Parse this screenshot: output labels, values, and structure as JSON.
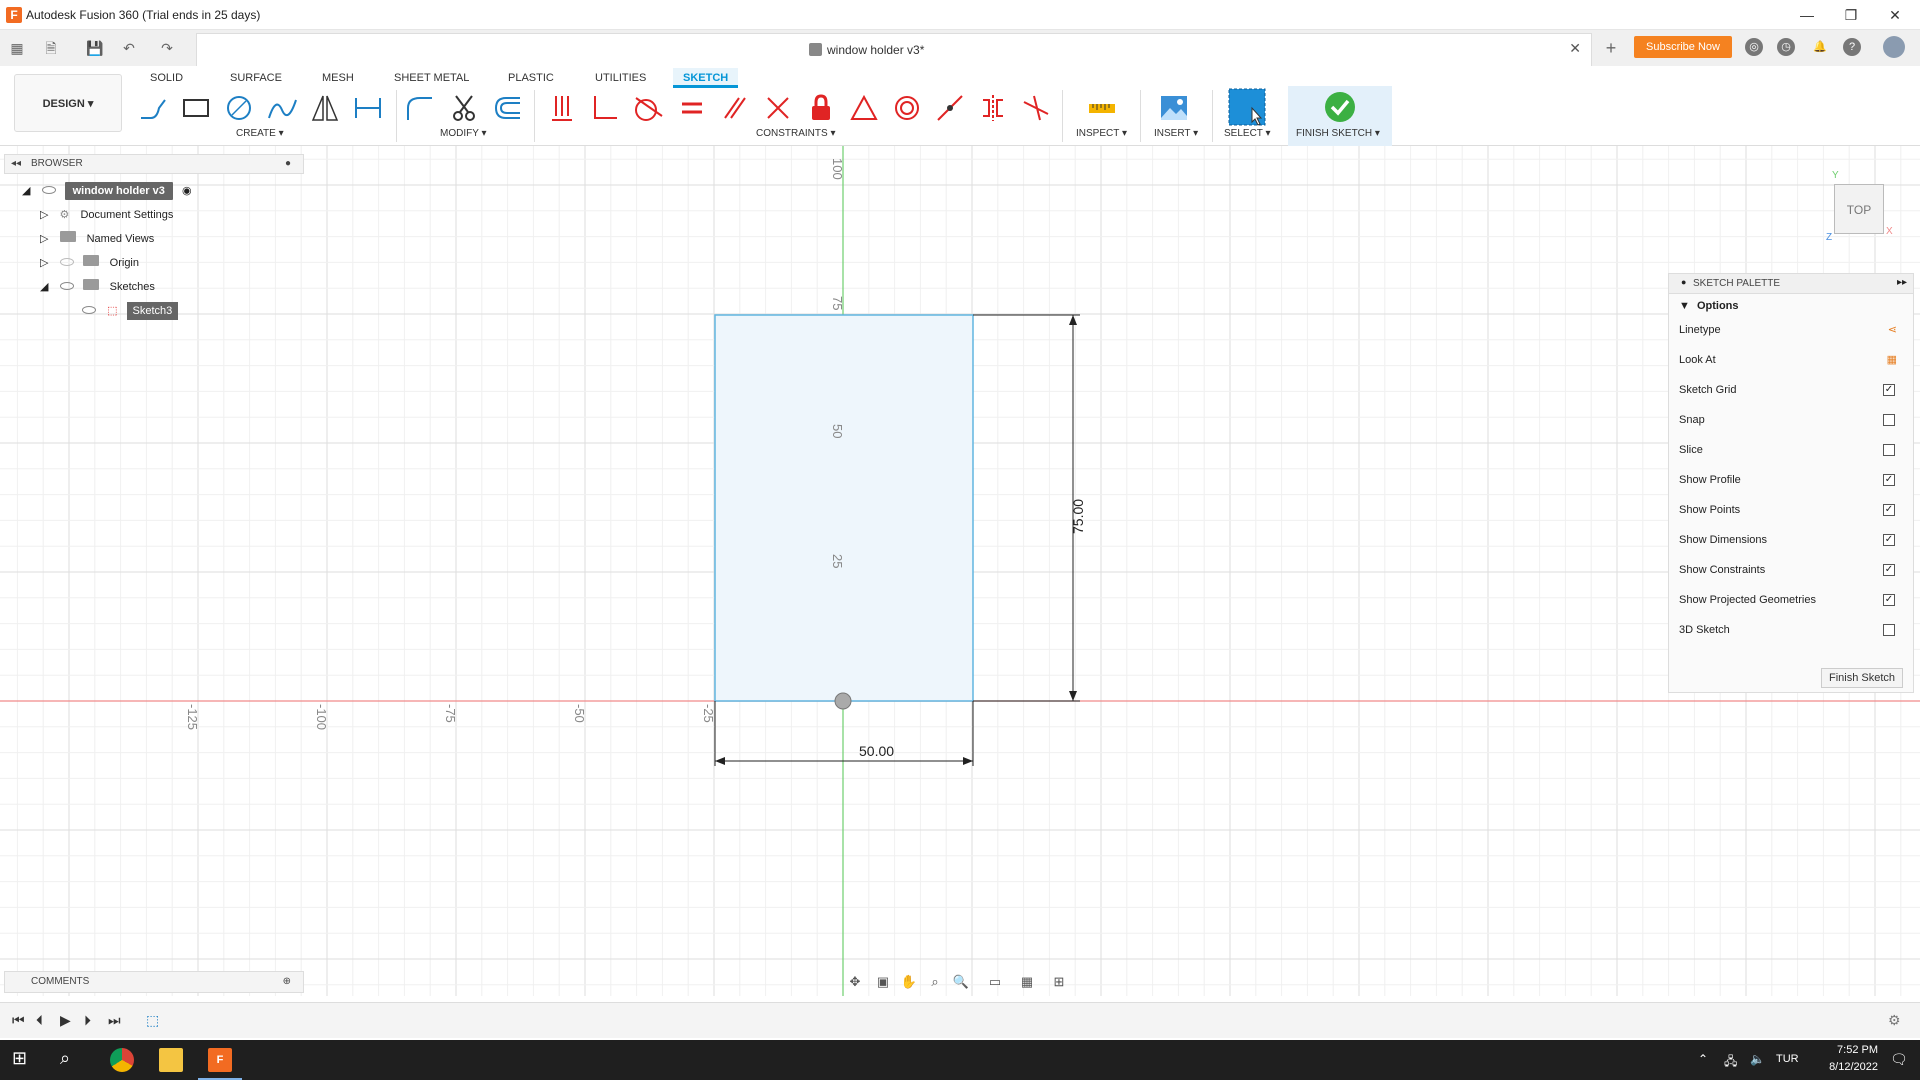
{
  "window": {
    "title": "Autodesk Fusion 360 (Trial ends in 25 days)",
    "logo_letter": "F",
    "minimize": "—",
    "maximize": "❐",
    "close": "✕"
  },
  "tabbar": {
    "doc_title": "window holder v3*",
    "doc_close": "✕",
    "new_tab": "+",
    "subscribe": "Subscribe Now"
  },
  "ribbon": {
    "workspace": "DESIGN ▾",
    "tabs": [
      "SOLID",
      "SURFACE",
      "MESH",
      "SHEET METAL",
      "PLASTIC",
      "UTILITIES",
      "SKETCH"
    ],
    "active_tab": "SKETCH",
    "groups": {
      "create": "CREATE ▾",
      "modify": "MODIFY ▾",
      "constraints": "CONSTRAINTS ▾",
      "inspect": "INSPECT ▾",
      "insert": "INSERT ▾",
      "select": "SELECT ▾",
      "finish": "FINISH SKETCH ▾"
    }
  },
  "browser": {
    "header": "BROWSER",
    "items": [
      {
        "label": "window holder v3"
      },
      {
        "label": "Document Settings"
      },
      {
        "label": "Named Views"
      },
      {
        "label": "Origin"
      },
      {
        "label": "Sketches"
      },
      {
        "label": "Sketch3"
      }
    ]
  },
  "comments": {
    "header": "COMMENTS"
  },
  "viewcube": {
    "face": "TOP",
    "x": "X",
    "y": "Y",
    "z": "Z"
  },
  "sketch": {
    "ruler_y": [
      "100",
      "75",
      "50",
      "25"
    ],
    "ruler_x": [
      "-125",
      "-100",
      "-75",
      "-50",
      "-25"
    ],
    "dim_height": "75.00",
    "dim_width": "50.00",
    "colors": {
      "fill": "#eef6fc",
      "edge": "#61b5e0",
      "x_axis": "#f08a8a",
      "y_axis": "#6fcf6f"
    }
  },
  "palette": {
    "header": "SKETCH PALETTE",
    "section": "Options",
    "rows": [
      {
        "label": "Linetype",
        "checked": null
      },
      {
        "label": "Look At",
        "checked": null
      },
      {
        "label": "Sketch Grid",
        "checked": true
      },
      {
        "label": "Snap",
        "checked": false
      },
      {
        "label": "Slice",
        "checked": false
      },
      {
        "label": "Show Profile",
        "checked": true
      },
      {
        "label": "Show Points",
        "checked": true
      },
      {
        "label": "Show Dimensions",
        "checked": true
      },
      {
        "label": "Show Constraints",
        "checked": true
      },
      {
        "label": "Show Projected Geometries",
        "checked": true
      },
      {
        "label": "3D Sketch",
        "checked": false
      }
    ],
    "finish_button": "Finish Sketch"
  },
  "taskbar": {
    "language": "TUR",
    "time": "7:52 PM",
    "date": "8/12/2022"
  }
}
